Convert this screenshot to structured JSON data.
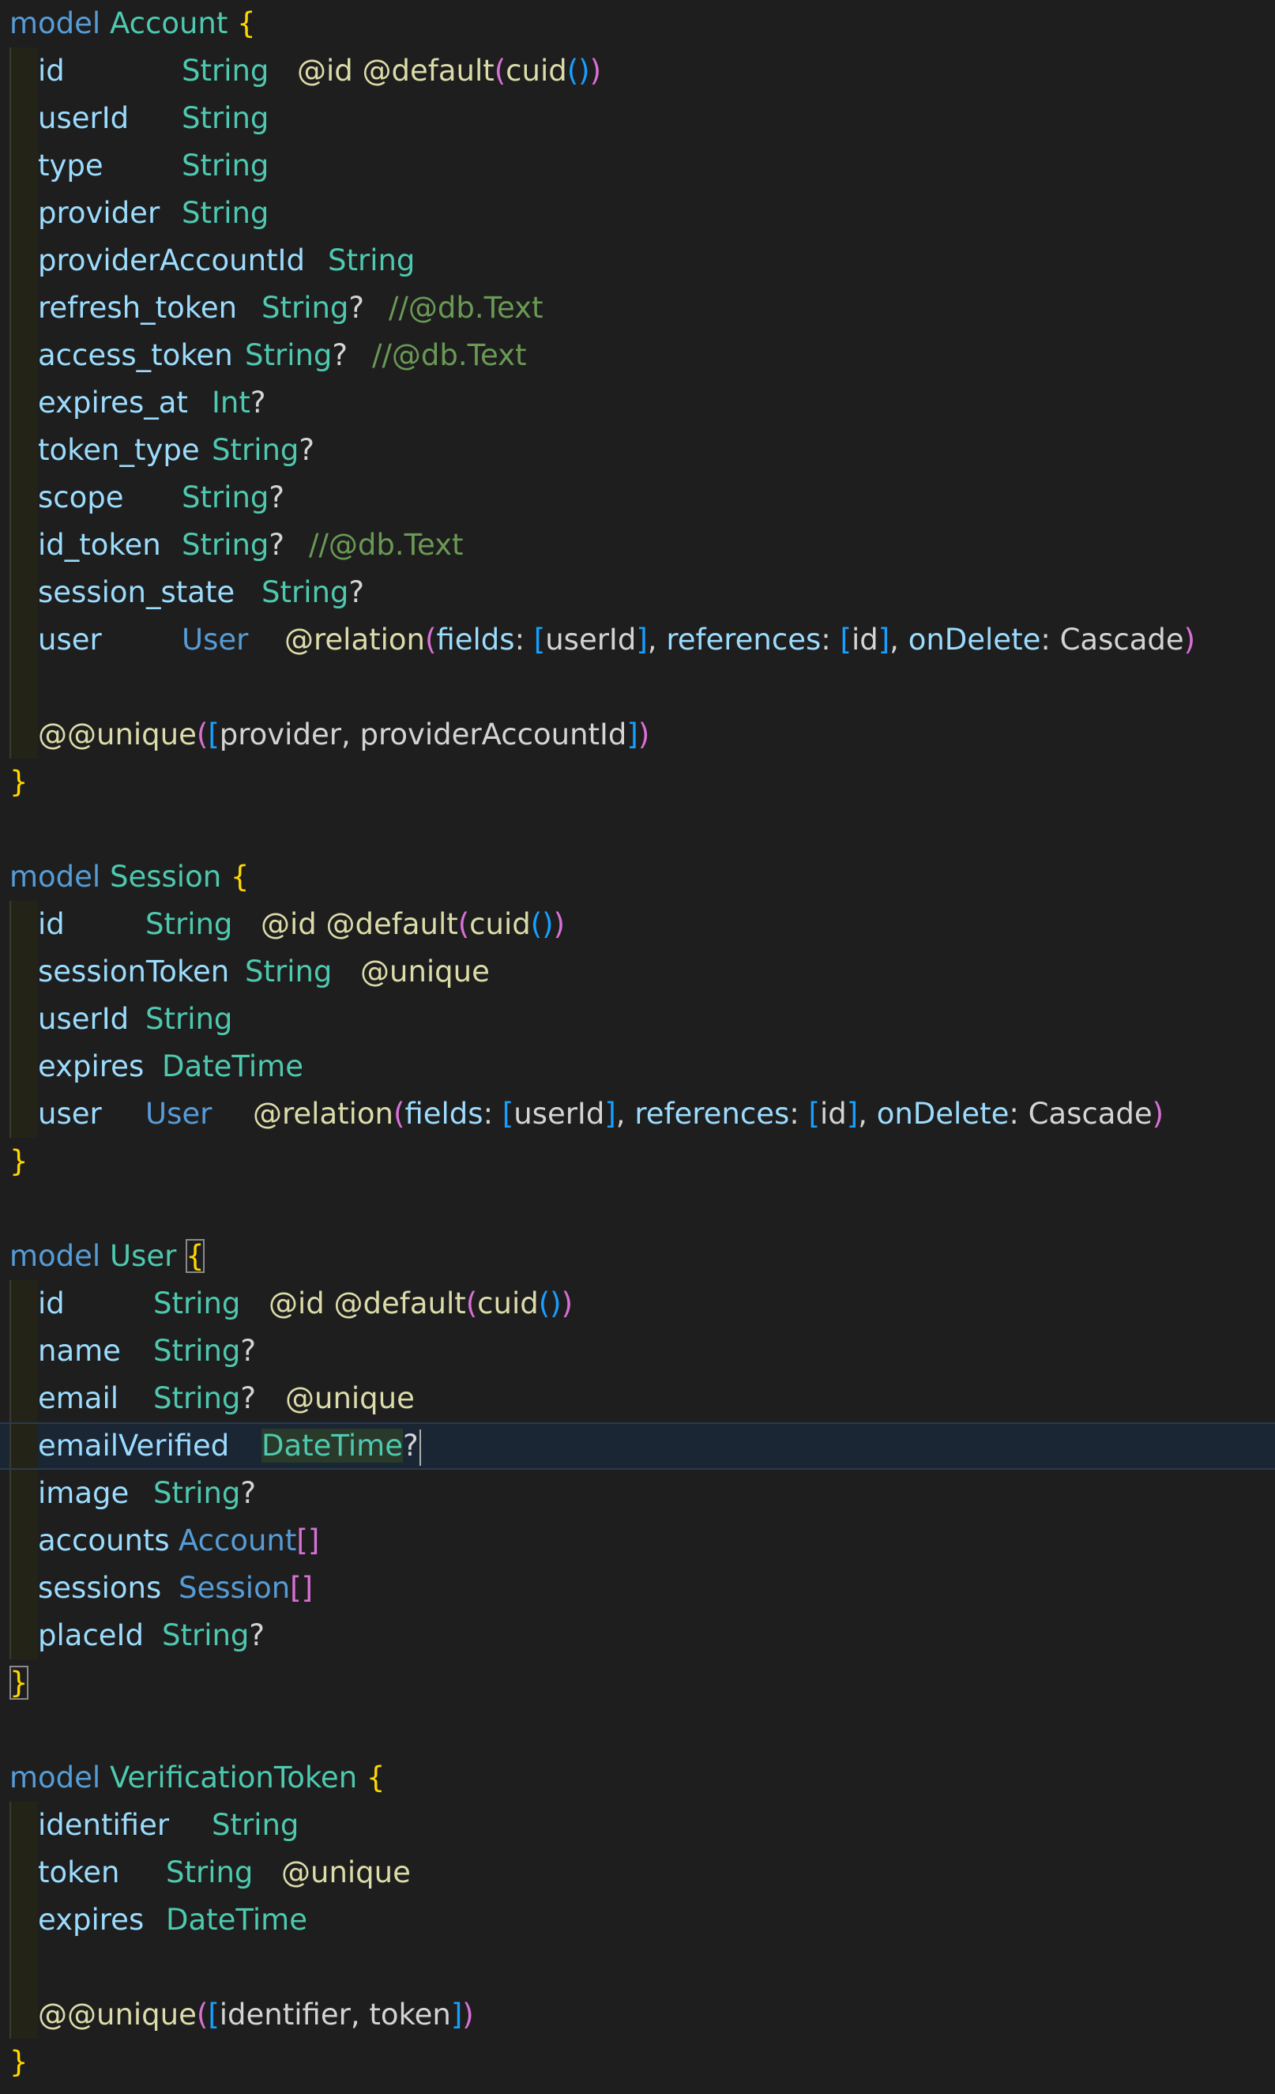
{
  "window": {
    "background": "#1e1e1e",
    "kind": "code-editor"
  },
  "colors": {
    "keyword": "#569cd6",
    "model_name": "#4ec9b0",
    "field": "#9cdcfe",
    "type": "#4ec9b0",
    "attribute": "#dcdcaa",
    "brace": "#ffd700",
    "paren_level2": "#da70d6",
    "paren_level3": "#179fff",
    "comment": "#6a9955",
    "plain": "#d4d4d4"
  },
  "models": [
    {
      "keyword": "model",
      "name": "Account",
      "open": "{",
      "close": "}",
      "fields": [
        {
          "name": "id",
          "type": "String",
          "rest": "@id @default(cuid())"
        },
        {
          "name": "userId",
          "type": "String",
          "rest": ""
        },
        {
          "name": "type",
          "type": "String",
          "rest": ""
        },
        {
          "name": "provider",
          "type": "String",
          "rest": ""
        },
        {
          "name": "providerAccountId",
          "type": "String",
          "rest": ""
        },
        {
          "name": "refresh_token",
          "type": "String?",
          "rest": "//@db.Text"
        },
        {
          "name": "access_token",
          "type": "String?",
          "rest": "//@db.Text"
        },
        {
          "name": "expires_at",
          "type": "Int?",
          "rest": ""
        },
        {
          "name": "token_type",
          "type": "String?",
          "rest": ""
        },
        {
          "name": "scope",
          "type": "String?",
          "rest": ""
        },
        {
          "name": "id_token",
          "type": "String?",
          "rest": "//@db.Text"
        },
        {
          "name": "session_state",
          "type": "String?",
          "rest": ""
        },
        {
          "name": "user",
          "type": "User",
          "rest": "@relation(fields: [userId], references: [id], onDelete: Cascade)"
        }
      ],
      "block_attribute": "@@unique([provider, providerAccountId])"
    },
    {
      "keyword": "model",
      "name": "Session",
      "open": "{",
      "close": "}",
      "fields": [
        {
          "name": "id",
          "type": "String",
          "rest": "@id @default(cuid())"
        },
        {
          "name": "sessionToken",
          "type": "String",
          "rest": "@unique"
        },
        {
          "name": "userId",
          "type": "String",
          "rest": ""
        },
        {
          "name": "expires",
          "type": "DateTime",
          "rest": ""
        },
        {
          "name": "user",
          "type": "User",
          "rest": "@relation(fields: [userId], references: [id], onDelete: Cascade)"
        }
      ],
      "block_attribute": ""
    },
    {
      "keyword": "model",
      "name": "User",
      "open": "{",
      "close": "}",
      "fields": [
        {
          "name": "id",
          "type": "String",
          "rest": "@id @default(cuid())"
        },
        {
          "name": "name",
          "type": "String?",
          "rest": ""
        },
        {
          "name": "email",
          "type": "String?",
          "rest": "@unique"
        },
        {
          "name": "emailVerified",
          "type": "DateTime?",
          "rest": ""
        },
        {
          "name": "image",
          "type": "String?",
          "rest": ""
        },
        {
          "name": "accounts",
          "type": "Account[]",
          "rest": ""
        },
        {
          "name": "sessions",
          "type": "Session[]",
          "rest": ""
        },
        {
          "name": "placeId",
          "type": "String?",
          "rest": ""
        }
      ],
      "block_attribute": ""
    },
    {
      "keyword": "model",
      "name": "VerificationToken",
      "open": "{",
      "close": "}",
      "fields": [
        {
          "name": "identifier",
          "type": "String",
          "rest": ""
        },
        {
          "name": "token",
          "type": "String",
          "rest": "@unique"
        },
        {
          "name": "expires",
          "type": "DateTime",
          "rest": ""
        }
      ],
      "block_attribute": "@@unique([identifier, token])"
    }
  ],
  "cursor": {
    "model": "User",
    "field": "emailVerified"
  }
}
